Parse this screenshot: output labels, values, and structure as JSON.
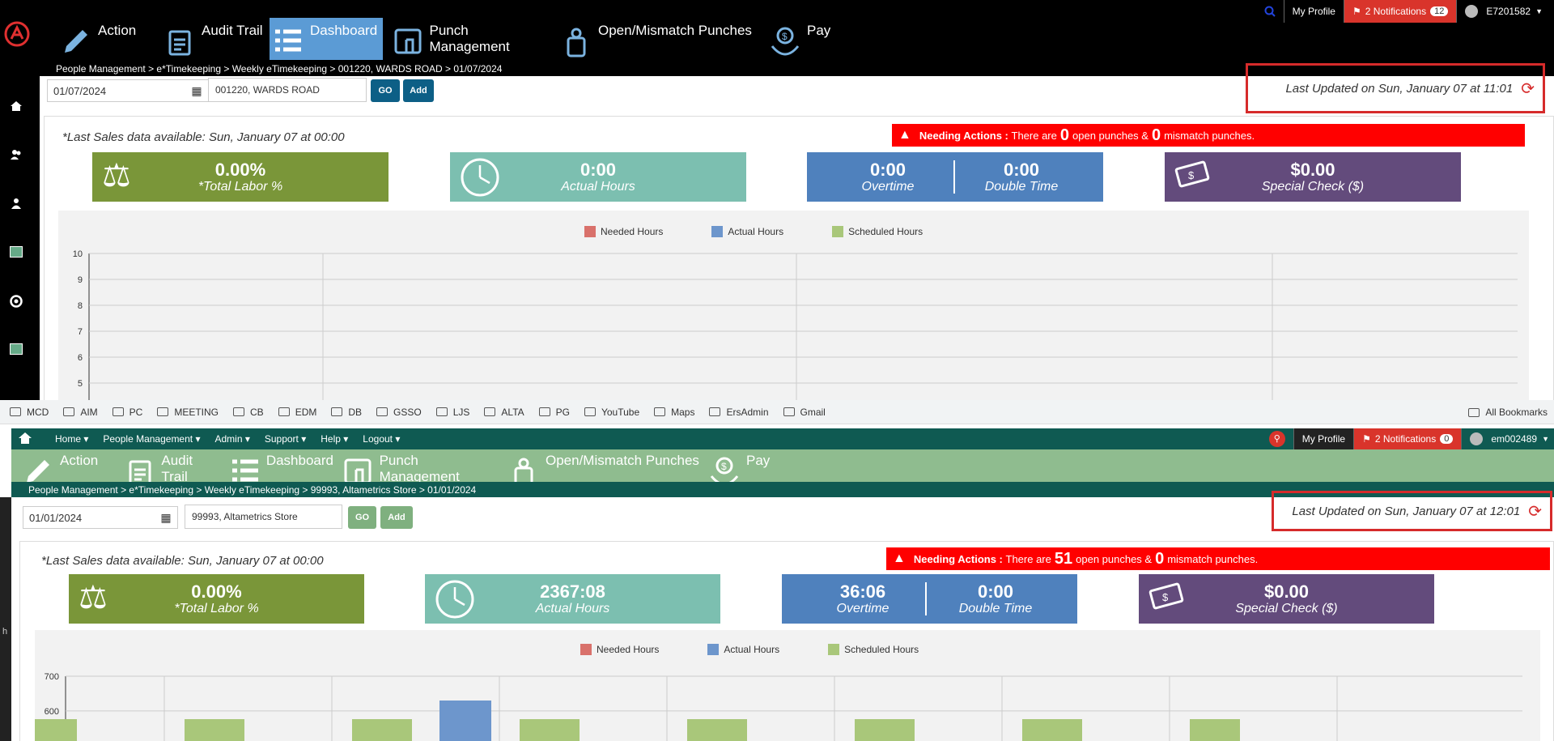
{
  "w1": {
    "topbar": {
      "my_profile": "My Profile",
      "notifications": "2 Notifications",
      "notif_count": "12",
      "user": "E7201582"
    },
    "nav": [
      {
        "label": "Action",
        "icon": "pencil-icon"
      },
      {
        "label": "Audit Trail",
        "icon": "clipboard-icon"
      },
      {
        "label": "Dashboard",
        "icon": "list-icon"
      },
      {
        "label": "Punch Management",
        "icon": "punch-icon"
      },
      {
        "label": "Open/Mismatch Punches",
        "icon": "door-hanger-icon"
      },
      {
        "label": "Pay",
        "icon": "money-hand-icon"
      }
    ],
    "breadcrumb": "People Management > e*Timekeeping > Weekly eTimekeeping  > 001220, WARDS ROAD > 01/07/2024",
    "date": "01/07/2024",
    "store": "001220, WARDS ROAD",
    "go": "GO",
    "add": "Add",
    "last_updated": "Last Updated on Sun, January 07 at 11:01",
    "last_sales": "*Last Sales data available: Sun, January 07 at 00:00",
    "needing": {
      "label": "Needing Actions :",
      "pre": "There are",
      "open": "0",
      "mid": "open punches &",
      "mismatch": "0",
      "post": "mismatch punches."
    },
    "tiles": {
      "labor": {
        "value": "0.00%",
        "label": "*Total Labor %"
      },
      "actual": {
        "value": "0:00",
        "label": "Actual Hours"
      },
      "overtime": {
        "value": "0:00",
        "label": "Overtime"
      },
      "double": {
        "value": "0:00",
        "label": "Double Time"
      },
      "special": {
        "value": "$0.00",
        "label": "Special Check ($)"
      }
    },
    "chart_data": {
      "type": "bar",
      "series": [
        {
          "name": "Needed Hours",
          "values": []
        },
        {
          "name": "Actual Hours",
          "values": []
        },
        {
          "name": "Scheduled Hours",
          "values": []
        }
      ],
      "yticks": [
        "10",
        "9",
        "8",
        "7",
        "6",
        "5"
      ],
      "ylim": [
        5,
        10
      ]
    }
  },
  "w2": {
    "bookmarks": [
      "MCD",
      "AIM",
      "PC",
      "MEETING",
      "CB",
      "EDM",
      "DB",
      "GSSO",
      "LJS",
      "ALTA",
      "PG",
      "YouTube",
      "Maps",
      "ErsAdmin",
      "Gmail"
    ],
    "all_bookmarks": "All Bookmarks",
    "menu": [
      "Home",
      "People Management",
      "Admin",
      "Support",
      "Help",
      "Logout"
    ],
    "topbar": {
      "my_profile": "My Profile",
      "notifications": "2 Notifications",
      "notif_count": "0",
      "user": "em002489"
    },
    "nav": [
      {
        "label": "Action",
        "icon": "pencil-icon"
      },
      {
        "label": "Audit Trail",
        "icon": "clipboard-icon"
      },
      {
        "label": "Dashboard",
        "icon": "list-icon"
      },
      {
        "label": "Punch Management",
        "icon": "punch-icon"
      },
      {
        "label": "Open/Mismatch Punches",
        "icon": "door-hanger-icon"
      },
      {
        "label": "Pay",
        "icon": "money-hand-icon"
      }
    ],
    "breadcrumb": "People Management > e*Timekeeping > Weekly eTimekeeping  > 99993, Altametrics Store > 01/01/2024",
    "date": "01/01/2024",
    "store": "99993, Altametrics Store",
    "go": "GO",
    "add": "Add",
    "last_updated": "Last Updated on Sun, January 07 at 12:01",
    "last_sales": "*Last Sales data available: Sun, January 07 at 00:00",
    "needing": {
      "label": "Needing Actions :",
      "pre": "There are",
      "open": "51",
      "mid": "open punches &",
      "mismatch": "0",
      "post": "mismatch punches."
    },
    "tiles": {
      "labor": {
        "value": "0.00%",
        "label": "*Total Labor %"
      },
      "actual": {
        "value": "2367:08",
        "label": "Actual Hours"
      },
      "overtime": {
        "value": "36:06",
        "label": "Overtime"
      },
      "double": {
        "value": "0:00",
        "label": "Double Time"
      },
      "special": {
        "value": "$0.00",
        "label": "Special Check ($)"
      }
    },
    "side_text": "h",
    "chart_data": {
      "type": "bar",
      "series": [
        {
          "name": "Needed Hours",
          "values": []
        },
        {
          "name": "Actual Hours",
          "values": [
            null,
            null,
            630,
            null,
            null,
            null,
            null
          ]
        },
        {
          "name": "Scheduled Hours",
          "values": []
        }
      ],
      "yticks": [
        "700",
        "600"
      ],
      "ylim": [
        560,
        700
      ]
    }
  },
  "colors": {
    "needed": "#d9716b",
    "actual": "#6d96cc",
    "scheduled": "#a9c77a",
    "labor": "#7a9639",
    "actualtile": "#7cbfb0",
    "overtime": "#4f81bd",
    "special": "#634b7c",
    "needing": "#ff0000",
    "w2menu": "#0f5a52",
    "w2nav": "#8fbc8f"
  }
}
